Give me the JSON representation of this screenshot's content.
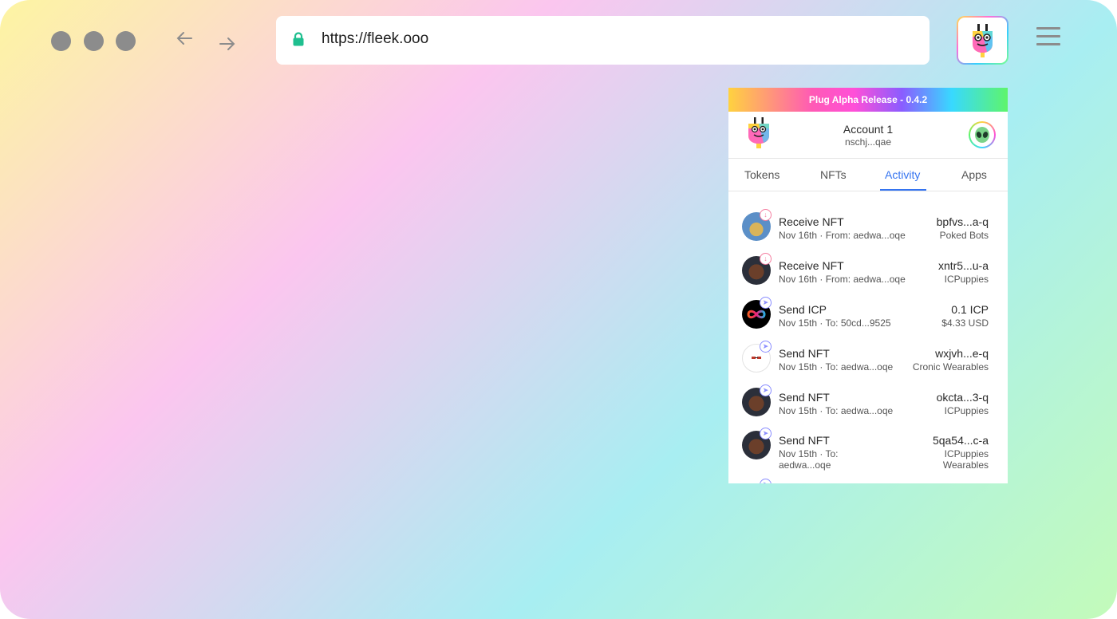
{
  "browser": {
    "url": "https://fleek.ooo",
    "back_icon": "arrow-left-icon",
    "forward_icon": "arrow-right-icon",
    "lock_color": "#1fbf8f"
  },
  "popup": {
    "banner": "Plug Alpha Release - 0.4.2",
    "account": {
      "name": "Account 1",
      "address": "nschj...qae"
    },
    "tabs": [
      {
        "label": "Tokens"
      },
      {
        "label": "NFTs"
      },
      {
        "label": "Activity",
        "active": true
      },
      {
        "label": "Apps"
      }
    ],
    "activity": [
      {
        "type": "receive",
        "title": "Receive NFT",
        "subtitle": "Nov 16th · From: aedwa...oqe",
        "value": "bpfvs...a-q",
        "value2": "Poked Bots"
      },
      {
        "type": "receive",
        "title": "Receive NFT",
        "subtitle": "Nov 16th · From: aedwa...oqe",
        "value": "xntr5...u-a",
        "value2": "ICPuppies"
      },
      {
        "type": "send",
        "title": "Send ICP",
        "subtitle": "Nov 15th · To: 50cd...9525",
        "value": "0.1 ICP",
        "value2": "$4.33 USD"
      },
      {
        "type": "send",
        "title": "Send NFT",
        "subtitle": "Nov 15th · To: aedwa...oqe",
        "value": "wxjvh...e-q",
        "value2": "Cronic Wearables"
      },
      {
        "type": "send",
        "title": "Send NFT",
        "subtitle": "Nov 15th · To: aedwa...oqe",
        "value": "okcta...3-q",
        "value2": "ICPuppies"
      },
      {
        "type": "send",
        "title": "Send NFT",
        "subtitle": "Nov 15th · To: aedwa...oqe",
        "value": "5qa54...c-a",
        "value2": "ICPuppies Wearables"
      }
    ]
  }
}
